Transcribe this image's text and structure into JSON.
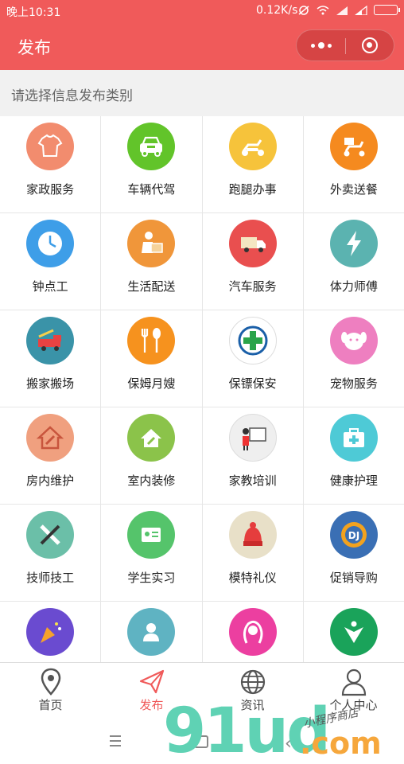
{
  "status_bar": {
    "time": "晚上10:31",
    "speed": "0.12K/s"
  },
  "nav": {
    "title": "发布"
  },
  "hint": "请选择信息发布类别",
  "categories": [
    {
      "label": "家政服务",
      "icon": "tshirt-icon",
      "color": "#f28c6e"
    },
    {
      "label": "车辆代驾",
      "icon": "car-icon",
      "color": "#62c42a"
    },
    {
      "label": "跑腿办事",
      "icon": "scooter-icon",
      "color": "#f6c33b"
    },
    {
      "label": "外卖送餐",
      "icon": "delivery-scooter-icon",
      "color": "#f58a1f"
    },
    {
      "label": "钟点工",
      "icon": "clock-icon",
      "color": "#3e9ee8"
    },
    {
      "label": "生活配送",
      "icon": "courier-icon",
      "color": "#f0963a"
    },
    {
      "label": "汽车服务",
      "icon": "truck-icon",
      "color": "#e94f4f"
    },
    {
      "label": "体力师傅",
      "icon": "lightning-icon",
      "color": "#5bb3b0"
    },
    {
      "label": "搬家搬场",
      "icon": "fire-truck-icon",
      "color": "#3a93a8"
    },
    {
      "label": "保姆月嫂",
      "icon": "fork-spoon-icon",
      "color": "#f6921e"
    },
    {
      "label": "保镖保安",
      "icon": "medical-cross-icon",
      "color": "#ffffff"
    },
    {
      "label": "宠物服务",
      "icon": "dog-face-icon",
      "color": "#ee7fc0"
    },
    {
      "label": "房内维护",
      "icon": "house-wrench-icon",
      "color": "#f0a07f"
    },
    {
      "label": "室内装修",
      "icon": "house-brush-icon",
      "color": "#8bc34a"
    },
    {
      "label": "家教培训",
      "icon": "teacher-board-icon",
      "color": "#efefef"
    },
    {
      "label": "健康护理",
      "icon": "first-aid-icon",
      "color": "#4ecad6"
    },
    {
      "label": "技师技工",
      "icon": "tools-icon",
      "color": "#6bbfa8"
    },
    {
      "label": "学生实习",
      "icon": "id-badge-icon",
      "color": "#55c46b"
    },
    {
      "label": "模特礼仪",
      "icon": "knit-hat-icon",
      "color": "#e8e0c8"
    },
    {
      "label": "促销导购",
      "icon": "dj-gear-icon",
      "color": "#3a6fb4"
    },
    {
      "label": "",
      "icon": "party-popper-icon",
      "color": "#6a4bd0"
    },
    {
      "label": "",
      "icon": "person-icon",
      "color": "#5fb3c2"
    },
    {
      "label": "",
      "icon": "woman-hair-icon",
      "color": "#ec3fa0"
    },
    {
      "label": "",
      "icon": "people-tree-icon",
      "color": "#1aa35a"
    }
  ],
  "tabs": [
    {
      "label": "首页",
      "icon": "location-pin-icon"
    },
    {
      "label": "发布",
      "icon": "paper-plane-icon",
      "active": true
    },
    {
      "label": "资讯",
      "icon": "globe-icon"
    },
    {
      "label": "个人中心",
      "icon": "user-icon"
    }
  ],
  "watermark": {
    "big": "91ud",
    "com": ".com",
    "small": "小程序商店"
  },
  "colors": {
    "brand": "#f05a5a",
    "active_tab": "#f05a5a"
  }
}
